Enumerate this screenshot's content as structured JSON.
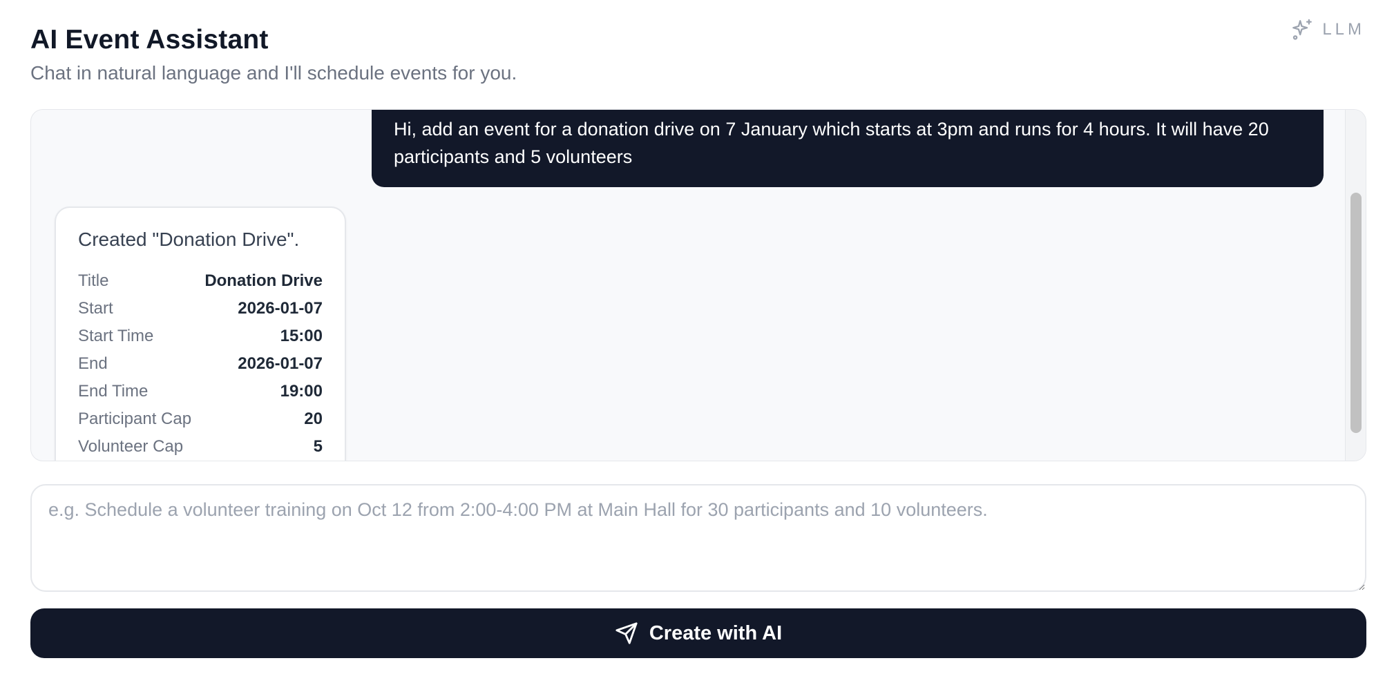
{
  "header": {
    "title": "AI Event Assistant",
    "subtitle": "Chat in natural language and I'll schedule events for you.",
    "badge_label": "LLM",
    "badge_icon": "sparkles-icon"
  },
  "chat": {
    "user_message": "Hi, add an event for a donation drive on 7 January which starts at 3pm and runs for 4 hours. It will have 20 participants and 5 volunteers",
    "bot_message": {
      "title": "Created \"Donation Drive\".",
      "details": [
        {
          "label": "Title",
          "value": "Donation Drive"
        },
        {
          "label": "Start",
          "value": "2026-01-07"
        },
        {
          "label": "Start Time",
          "value": "15:00"
        },
        {
          "label": "End",
          "value": "2026-01-07"
        },
        {
          "label": "End Time",
          "value": "19:00"
        },
        {
          "label": "Participant Cap",
          "value": "20"
        },
        {
          "label": "Volunteer Cap",
          "value": "5"
        }
      ]
    }
  },
  "composer": {
    "placeholder": "e.g. Schedule a volunteer training on Oct 12 from 2:00-4:00 PM at Main Hall for 30 participants and 10 volunteers.",
    "value": ""
  },
  "submit": {
    "label": "Create with AI",
    "icon": "send-icon"
  },
  "colors": {
    "primary_dark": "#121829",
    "muted_text": "#6b7280",
    "panel_bg": "#f8f9fb",
    "border": "#e5e7eb"
  }
}
